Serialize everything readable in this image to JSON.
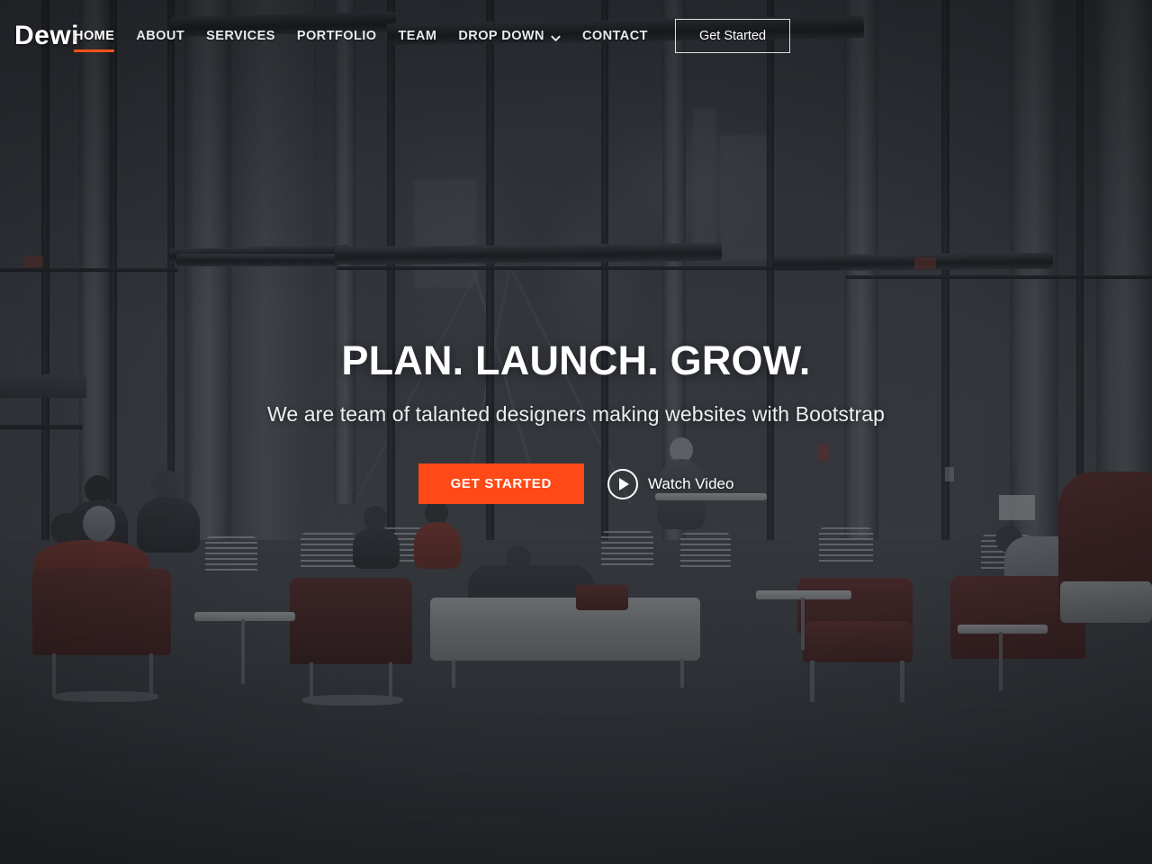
{
  "site": {
    "logo": "Dewi"
  },
  "nav": {
    "items": [
      {
        "label": "HOME",
        "name": "nav-item-home",
        "active": true,
        "dropdown": false
      },
      {
        "label": "ABOUT",
        "name": "nav-item-about",
        "active": false,
        "dropdown": false
      },
      {
        "label": "SERVICES",
        "name": "nav-item-services",
        "active": false,
        "dropdown": false
      },
      {
        "label": "PORTFOLIO",
        "name": "nav-item-portfolio",
        "active": false,
        "dropdown": false
      },
      {
        "label": "TEAM",
        "name": "nav-item-team",
        "active": false,
        "dropdown": false
      },
      {
        "label": "DROP DOWN",
        "name": "nav-item-dropdown",
        "active": false,
        "dropdown": true
      },
      {
        "label": "CONTACT",
        "name": "nav-item-contact",
        "active": false,
        "dropdown": false
      }
    ],
    "cta_label": "Get Started",
    "dropdown_icon": "chevron-down-icon"
  },
  "hero": {
    "title": "PLAN. LAUNCH. GROW.",
    "subtitle": "We are team of talanted designers making websites with Bootstrap",
    "primary_button": "GET STARTED",
    "video_button": "Watch Video",
    "video_icon": "play-circle-icon"
  },
  "colors": {
    "accent": "#ff4a17",
    "active_underline": "#f2511b",
    "text_light": "#ffffff",
    "background_dark": "#3a3e45"
  }
}
